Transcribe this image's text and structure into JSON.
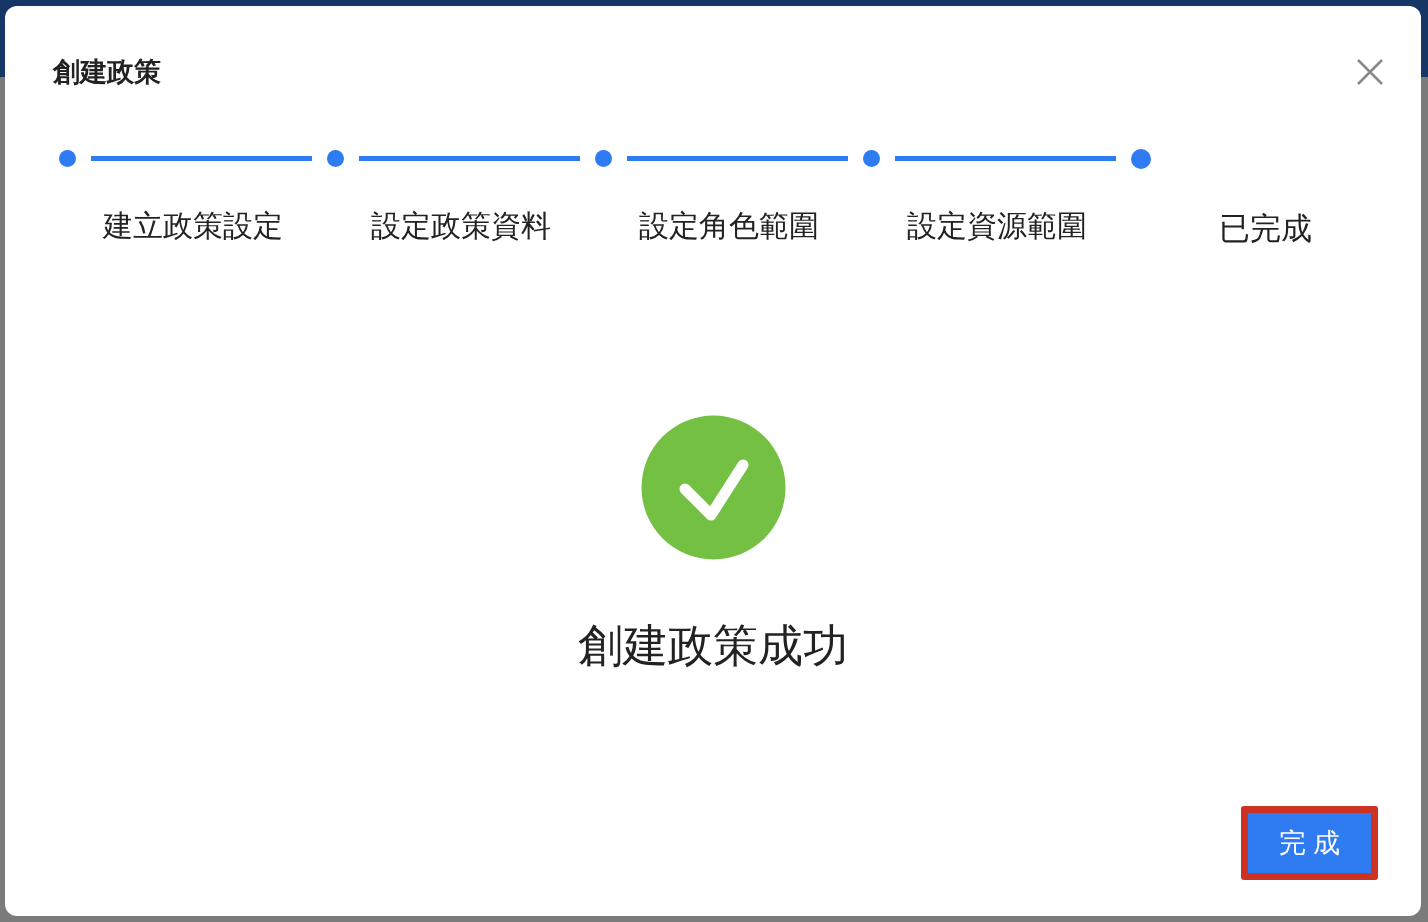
{
  "dialog": {
    "title": "創建政策",
    "steps": [
      {
        "label": "建立政策設定",
        "current": false
      },
      {
        "label": "設定政策資料",
        "current": false
      },
      {
        "label": "設定角色範圍",
        "current": false
      },
      {
        "label": "設定資源範圍",
        "current": false
      },
      {
        "label": "已完成",
        "current": true
      }
    ],
    "message": "創建政策成功",
    "button": "完 成"
  }
}
